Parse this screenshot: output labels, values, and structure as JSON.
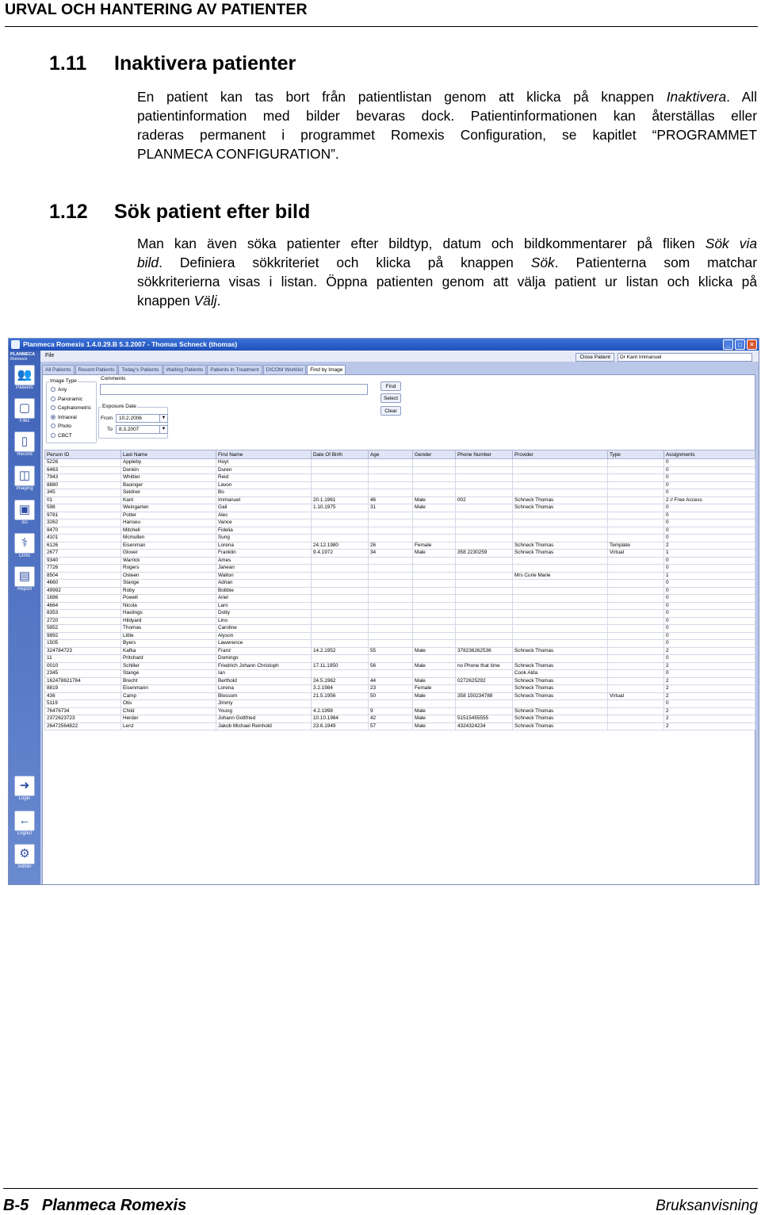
{
  "header": {
    "title": "URVAL OCH HANTERING AV PATIENTER"
  },
  "sections": [
    {
      "number": "1.11",
      "title": "Inaktivera patienter",
      "lines": [
        [
          "En patient kan tas bort från patientlistan genom att klicka på knappen ",
          "Inaktivera",
          ". All"
        ],
        [
          "patientinformation med bilder bevaras dock. Patientinformationen kan återställas eller"
        ],
        [
          "raderas permanent i programmet Romexis Configuration, se kapitlet “PROGRAMMET"
        ],
        [
          "PLANMECA CONFIGURATION”."
        ]
      ]
    },
    {
      "number": "1.12",
      "title": "Sök patient efter bild",
      "lines": [
        [
          "Man kan även söka patienter efter bildtyp, datum och bildkommentarer på fliken ",
          "Sök via"
        ],
        [
          "",
          "bild",
          ". Definiera sökkriteriet och klicka på knappen ",
          "Sök",
          ". Patienterna som matchar"
        ],
        [
          "sökkriterierna visas i listan. Öppna patienten genom att välja patient ur listan och klicka på"
        ],
        [
          "knappen ",
          "Välj",
          "."
        ]
      ]
    }
  ],
  "screenshot": {
    "window_title": "Planmeca Romexis 1.4.0.29.B  5.3.2007 - Thomas Schneck (thomas)",
    "menu": "File",
    "logo": "PLANMECA",
    "logo_sub": "Romexis",
    "close_patient": "Close Patient",
    "current_patient": "Dr Kant Immanuel",
    "window_buttons": [
      "_",
      "□",
      "×"
    ],
    "sidebar": [
      {
        "label": "Patients",
        "icon": "patients-icon"
      },
      {
        "label": "Files",
        "icon": "files-icon"
      },
      {
        "label": "Record",
        "icon": "record-icon"
      },
      {
        "label": "Imaging",
        "icon": "imaging-icon"
      },
      {
        "label": "3D",
        "icon": "3d-icon"
      },
      {
        "label": "Clinic",
        "icon": "clinic-icon"
      },
      {
        "label": "Report",
        "icon": "report-icon"
      },
      {
        "label": "Login",
        "icon": "login-icon"
      },
      {
        "label": "Logout",
        "icon": "logout-icon"
      },
      {
        "label": "Admin",
        "icon": "admin-icon"
      }
    ],
    "tabs": [
      "All Patients",
      "Recent Patients",
      "Today's Patients",
      "Waiting Patients",
      "Patients in Treatment",
      "DICOM Worklist",
      "Find by Image"
    ],
    "active_tab": 6,
    "image_type": {
      "title": "Image Type",
      "options": [
        "Any",
        "Panoramic",
        "Cephalometric",
        "Intraoral",
        "Photo",
        "CBCT"
      ],
      "selected": 3
    },
    "comments_label": "Comments",
    "exposure": {
      "title": "Exposure Date",
      "from_label": "From",
      "from": "10.2.2006",
      "to_label": "To",
      "to": "8.3.2007"
    },
    "buttons": [
      "Find",
      "Select",
      "Clear"
    ],
    "columns": [
      "Person ID",
      "Last Name",
      "First Name",
      "Date Of Birth",
      "Age",
      "Gender",
      "Phone Number",
      "Provider",
      "Type",
      "Assignments"
    ],
    "rows": [
      [
        "5226",
        "Appleby",
        "Hoyt",
        "",
        "",
        "",
        "",
        "",
        "",
        "0"
      ],
      [
        "6463",
        "Donkin",
        "Duren",
        "",
        "",
        "",
        "",
        "",
        "",
        "0"
      ],
      [
        "7943",
        "Whittier",
        "Reid",
        "",
        "",
        "",
        "",
        "",
        "",
        "0"
      ],
      [
        "8880",
        "Basinger",
        "Lavon",
        "",
        "",
        "",
        "",
        "",
        "",
        "0"
      ],
      [
        "345",
        "Seldner",
        "Bo",
        "",
        "",
        "",
        "",
        "",
        "",
        "0"
      ],
      [
        "01",
        "Kant",
        "Immanuel",
        "20.1.1961",
        "46",
        "Male",
        "002",
        "Schneck Thomas",
        "",
        "2 // Free Access"
      ],
      [
        "598",
        "Weingarten",
        "Gail",
        "1.10.1975",
        "31",
        "Male",
        "",
        "Schneck Thomas",
        "",
        "0"
      ],
      [
        "9781",
        "Potter",
        "Alec",
        "",
        "",
        "",
        "",
        "",
        "",
        "0"
      ],
      [
        "3262",
        "Hanseu",
        "Vance",
        "",
        "",
        "",
        "",
        "",
        "",
        "0"
      ],
      [
        "8470",
        "Mitchell",
        "Fidelia",
        "",
        "",
        "",
        "",
        "",
        "",
        "0"
      ],
      [
        "4101",
        "Mcmullen",
        "Sung",
        "",
        "",
        "",
        "",
        "",
        "",
        "0"
      ],
      [
        "6126",
        "Eisenman",
        "Lorena",
        "24.12.1980",
        "26",
        "Female",
        "",
        "Schneck Thomas",
        "Template",
        "2"
      ],
      [
        "2677",
        "Glover",
        "Franklin",
        "9.4.1972",
        "34",
        "Male",
        "358 2230259",
        "Schneck Thomas",
        "Virtual",
        "1"
      ],
      [
        "9340",
        "Warrick",
        "Ames",
        "",
        "",
        "",
        "",
        "",
        "",
        "0"
      ],
      [
        "7726",
        "Rogers",
        "Janean",
        "",
        "",
        "",
        "",
        "",
        "",
        "0"
      ],
      [
        "8504",
        "Osteen",
        "Walton",
        "",
        "",
        "",
        "",
        "Mrs Curie Marie",
        "",
        "1"
      ],
      [
        "4660",
        "Stange",
        "Adrian",
        "",
        "",
        "",
        "",
        "",
        "",
        "0"
      ],
      [
        "49992",
        "Roby",
        "Bobbie",
        "",
        "",
        "",
        "",
        "",
        "",
        "0"
      ],
      [
        "1686",
        "Powell",
        "Ariel",
        "",
        "",
        "",
        "",
        "",
        "",
        "0"
      ],
      [
        "4664",
        "Nicola",
        "Lani",
        "",
        "",
        "",
        "",
        "",
        "",
        "0"
      ],
      [
        "8353",
        "Hastings",
        "Dotty",
        "",
        "",
        "",
        "",
        "",
        "",
        "0"
      ],
      [
        "2720",
        "Hildyard",
        "Lino",
        "",
        "",
        "",
        "",
        "",
        "",
        "0"
      ],
      [
        "5852",
        "Thomas",
        "Caroline",
        "",
        "",
        "",
        "",
        "",
        "",
        "0"
      ],
      [
        "9892",
        "Little",
        "Alyson",
        "",
        "",
        "",
        "",
        "",
        "",
        "0"
      ],
      [
        "1505",
        "Byers",
        "Lawerence",
        "",
        "",
        "",
        "",
        "",
        "",
        "0"
      ],
      [
        "324784723",
        "Kafka",
        "Franz",
        "14.2.1952",
        "55",
        "Male",
        "378236262536",
        "Schneck Thomas",
        "",
        "2"
      ],
      [
        "11",
        "Pritchard",
        "Domingo",
        "",
        "",
        "",
        "",
        "",
        "",
        "0"
      ],
      [
        "0010",
        "Schiller",
        "Friedrich Johann Christoph",
        "17.11.1950",
        "56",
        "Male",
        "no Phone that time",
        "Schneck Thomas",
        "",
        "2"
      ],
      [
        "2345",
        "Stange",
        "Ian",
        "",
        "",
        "",
        "",
        "Cook Alda",
        "",
        "0"
      ],
      [
        "16247862178​4",
        "Brecht",
        "Berthold",
        "24.5.1962",
        "44",
        "Male",
        "0272625292",
        "Schneck Thomas",
        "",
        "2"
      ],
      [
        "8819",
        "Eisenmann",
        "Lorena",
        "3.2.1984",
        "23",
        "Female",
        "",
        "Schneck Thomas",
        "",
        "2"
      ],
      [
        "436",
        "Camp",
        "Blossom",
        "21.5.1956",
        "50",
        "Male",
        "358 150234788",
        "Schneck Thomas",
        "Virtual",
        "2"
      ],
      [
        "5119",
        "Otis",
        "Jimmy",
        "",
        "",
        "",
        "",
        "",
        "",
        "0"
      ],
      [
        "76476734",
        "Child",
        "Young",
        "4.2.1998",
        "9",
        "Male",
        "",
        "Schneck Thomas",
        "",
        "2"
      ],
      [
        "2372623723",
        "Herder",
        "Johann Gottfried",
        "10.10.1964",
        "42",
        "Male",
        "51515455555",
        "Schneck Thomas",
        "",
        "2"
      ],
      [
        "2647256482​2",
        "Lenz",
        "Jakob Michael Reinhold",
        "23.6.1949",
        "57",
        "Male",
        "4324324234",
        "Schneck Thomas",
        "",
        "2"
      ]
    ]
  },
  "footer": {
    "left": "B-5   Planmeca Romexis",
    "right": "Bruksanvisning"
  }
}
